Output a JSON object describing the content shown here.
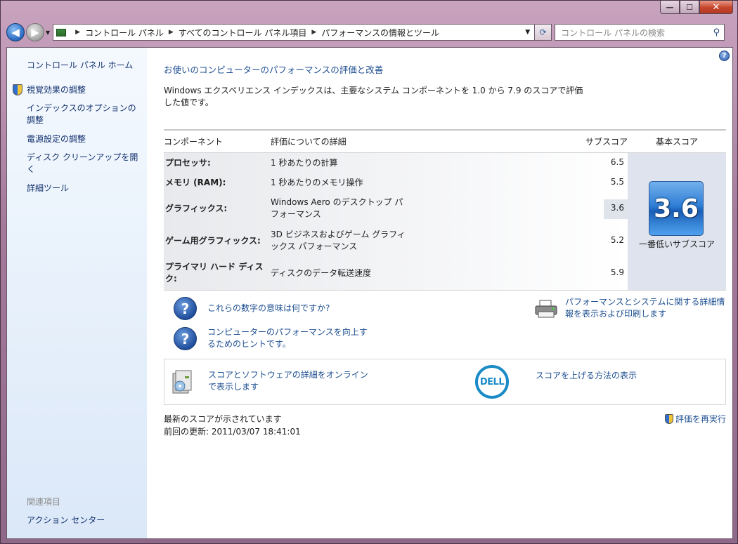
{
  "window": {
    "minimize_glyph": "—",
    "maximize_glyph": "☐",
    "close_glyph": "✕"
  },
  "address_bar": {
    "crumbs": [
      "コントロール パネル",
      "すべてのコントロール パネル項目",
      "パフォーマンスの情報とツール"
    ],
    "search_placeholder": "コントロール パネルの検索"
  },
  "sidebar": {
    "home": "コントロール パネル ホーム",
    "items": [
      {
        "label": "視覚効果の調整"
      },
      {
        "label": "インデックスのオプションの調整"
      },
      {
        "label": "電源設定の調整"
      },
      {
        "label": "ディスク クリーンアップを開く"
      },
      {
        "label": "詳細ツール"
      }
    ],
    "related_title": "関連項目",
    "related_links": [
      "アクション センター"
    ]
  },
  "main": {
    "title": "お使いのコンピューターのパフォーマンスの評価と改善",
    "description": "Windows エクスペリエンス インデックスは、主要なシステム コンポーネントを 1.0 から 7.9 のスコアで評価した値です。",
    "table": {
      "headers": {
        "component": "コンポーネント",
        "details": "評価についての詳細",
        "subscore": "サブスコア",
        "base": "基本スコア"
      },
      "rows": [
        {
          "component": "プロセッサ:",
          "details": "1 秒あたりの計算",
          "subscore": "6.5"
        },
        {
          "component": "メモリ (RAM):",
          "details": "1 秒あたりのメモリ操作",
          "subscore": "5.5"
        },
        {
          "component": "グラフィックス:",
          "details": "Windows Aero のデスクトップ パフォーマンス",
          "subscore": "3.6"
        },
        {
          "component": "ゲーム用グラフィックス:",
          "details": "3D ビジネスおよびゲーム グラフィックス パフォーマンス",
          "subscore": "5.2"
        },
        {
          "component": "プライマリ ハード ディスク:",
          "details": "ディスクのデータ転送速度",
          "subscore": "5.9"
        }
      ],
      "base_score": "3.6",
      "base_score_label": "一番低いサブスコア"
    },
    "links": {
      "what_mean": "これらの数字の意味は何ですか?",
      "tips": "コンピューターのパフォーマンスを向上するためのヒントです。",
      "print_details": "パフォーマンスとシステムに関する詳細情報を表示および印刷します",
      "online_details": "スコアとソフトウェアの詳細をオンラインで表示します",
      "raise_score": "スコアを上げる方法の表示"
    },
    "dell_logo_text": "DELL",
    "status": "最新のスコアが示されています",
    "last_update": "前回の更新: 2011/03/07 18:41:01",
    "rerun": "評価を再実行"
  }
}
